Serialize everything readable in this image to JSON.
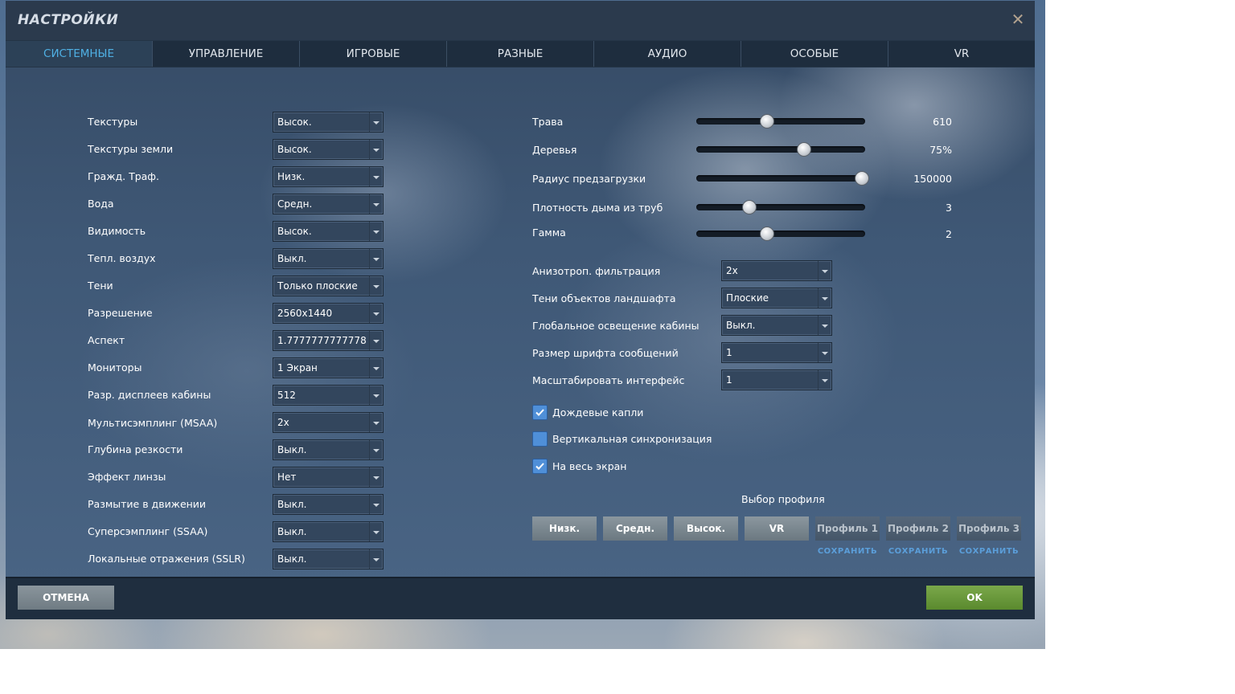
{
  "window": {
    "title": "НАСТРОЙКИ",
    "close_icon": "close-icon"
  },
  "tabs": [
    {
      "label": "СИСТЕМНЫЕ",
      "active": true
    },
    {
      "label": "УПРАВЛЕНИЕ"
    },
    {
      "label": "ИГРОВЫЕ"
    },
    {
      "label": "РАЗНЫЕ"
    },
    {
      "label": "АУДИО"
    },
    {
      "label": "ОСОБЫЕ"
    },
    {
      "label": "VR"
    }
  ],
  "left_settings": [
    {
      "label": "Текстуры",
      "value": "Высок."
    },
    {
      "label": "Текстуры земли",
      "value": "Высок."
    },
    {
      "label": "Гражд. Траф.",
      "value": "Низк."
    },
    {
      "label": "Вода",
      "value": "Средн."
    },
    {
      "label": "Видимость",
      "value": "Высок."
    },
    {
      "label": "Тепл. воздух",
      "value": "Выкл."
    },
    {
      "label": "Тени",
      "value": "Только плоские"
    },
    {
      "label": "Разрешение",
      "value": "2560x1440"
    },
    {
      "label": "Аспект",
      "value": "1.7777777777778"
    },
    {
      "label": "Мониторы",
      "value": "1 Экран"
    },
    {
      "label": "Разр. дисплеев кабины",
      "value": "512"
    },
    {
      "label": "Мультисэмплинг (MSAA)",
      "value": "2x"
    },
    {
      "label": "Глубина резкости",
      "value": "Выкл."
    },
    {
      "label": "Эффект линзы",
      "value": "Нет"
    },
    {
      "label": "Размытие в движении",
      "value": "Выкл."
    },
    {
      "label": "Суперсэмплинг (SSAA)",
      "value": "Выкл."
    },
    {
      "label": "Локальные отражения (SSLR)",
      "value": "Выкл."
    }
  ],
  "sliders": [
    {
      "label": "Трава",
      "value": "610",
      "fraction": 0.41
    },
    {
      "label": "Деревья",
      "value": "75%",
      "fraction": 0.64
    },
    {
      "label": "Радиус предзагрузки",
      "value": "150000",
      "fraction": 1.0
    },
    {
      "label": "Плотность дыма из труб",
      "value": "3",
      "fraction": 0.3
    },
    {
      "label": "Гамма",
      "value": "2",
      "fraction": 0.41
    }
  ],
  "right_settings": [
    {
      "label": "Анизотроп. фильтрация",
      "value": "2x"
    },
    {
      "label": "Тени объектов ландшафта",
      "value": "Плоские"
    },
    {
      "label": "Глобальное освещение кабины",
      "value": "Выкл."
    },
    {
      "label": "Размер шрифта сообщений",
      "value": "1"
    },
    {
      "label": "Масштабировать интерфейс",
      "value": "1"
    }
  ],
  "checkboxes": [
    {
      "label": "Дождевые капли",
      "checked": true
    },
    {
      "label": "Вертикальная синхронизация",
      "checked": false
    },
    {
      "label": "На весь экран",
      "checked": true
    }
  ],
  "profile": {
    "title": "Выбор профиля",
    "presets": [
      "Низк.",
      "Средн.",
      "Высок.",
      "VR"
    ],
    "custom": [
      "Профиль 1",
      "Профиль 2",
      "Профиль 3"
    ],
    "save_label": "СОХРАНИТЬ"
  },
  "footer": {
    "cancel_label": "ОТМЕНА",
    "ok_label": "OK"
  },
  "colors": {
    "accent_tab": "#4fb0e4",
    "checkbox": "#4f8fd8",
    "ok_button": "#6a9a3c"
  }
}
